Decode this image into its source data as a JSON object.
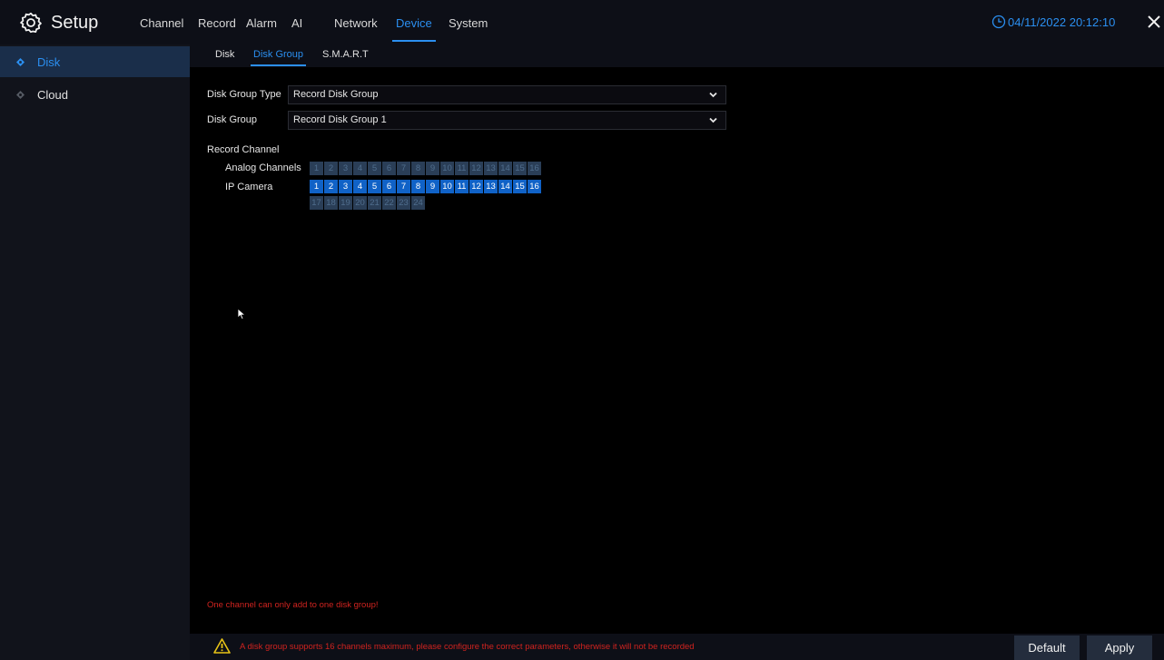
{
  "header": {
    "title": "Setup",
    "nav": [
      "Channel",
      "Record",
      "Alarm",
      "AI",
      "Network",
      "Device",
      "System"
    ],
    "active_nav": "Device",
    "datetime": "04/11/2022 20:12:10"
  },
  "sidebar": {
    "items": [
      {
        "label": "Disk",
        "active": true
      },
      {
        "label": "Cloud",
        "active": false
      }
    ]
  },
  "subtabs": {
    "items": [
      "Disk",
      "Disk Group",
      "S.M.A.R.T"
    ],
    "active": "Disk Group"
  },
  "form": {
    "disk_group_type_label": "Disk Group Type",
    "disk_group_type_value": "Record Disk Group",
    "disk_group_label": "Disk Group",
    "disk_group_value": "Record Disk Group 1",
    "record_channel_label": "Record Channel",
    "analog_label": "Analog Channels",
    "ip_label": "IP Camera",
    "analog_channels": [
      "1",
      "2",
      "3",
      "4",
      "5",
      "6",
      "7",
      "8",
      "9",
      "10",
      "11",
      "12",
      "13",
      "14",
      "15",
      "16"
    ],
    "ip_channels_row1": [
      "1",
      "2",
      "3",
      "4",
      "5",
      "6",
      "7",
      "8",
      "9",
      "10",
      "11",
      "12",
      "13",
      "14",
      "15",
      "16"
    ],
    "ip_channels_row2": [
      "17",
      "18",
      "19",
      "20",
      "21",
      "22",
      "23",
      "24"
    ]
  },
  "messages": {
    "note": "One channel can only add to one disk group!",
    "warning": "A disk group supports 16 channels maximum, please configure the correct parameters, otherwise it will not be recorded"
  },
  "buttons": {
    "default": "Default",
    "apply": "Apply"
  },
  "colors": {
    "accent": "#2b8ff0",
    "warning_text": "#d0231f",
    "channel_selected": "#1062c7",
    "channel_unselected": "#2a3e57"
  }
}
